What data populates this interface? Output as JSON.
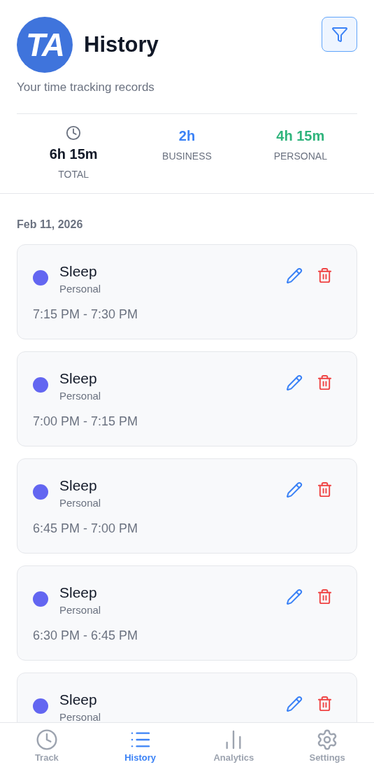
{
  "header": {
    "logo": "TA",
    "title": "History",
    "subtitle": "Your time tracking records"
  },
  "stats": [
    {
      "kind": "total",
      "value": "6h 15m",
      "label": "TOTAL"
    },
    {
      "kind": "business",
      "value": "2h",
      "label": "BUSINESS"
    },
    {
      "kind": "personal",
      "value": "4h 15m",
      "label": "PERSONAL"
    }
  ],
  "date": "Feb 11, 2026",
  "entries": [
    {
      "title": "Sleep",
      "category": "Personal",
      "color": "#6366f1",
      "time": "7:15 PM - 7:30 PM"
    },
    {
      "title": "Sleep",
      "category": "Personal",
      "color": "#6366f1",
      "time": "7:00 PM - 7:15 PM"
    },
    {
      "title": "Sleep",
      "category": "Personal",
      "color": "#6366f1",
      "time": "6:45 PM - 7:00 PM"
    },
    {
      "title": "Sleep",
      "category": "Personal",
      "color": "#6366f1",
      "time": "6:30 PM - 6:45 PM"
    },
    {
      "title": "Sleep",
      "category": "Personal",
      "color": "#6366f1"
    }
  ],
  "nav": [
    {
      "kind": "clock",
      "label": "Track",
      "selected": false
    },
    {
      "kind": "list",
      "label": "History",
      "selected": true
    },
    {
      "kind": "chart",
      "label": "Analytics",
      "selected": false
    },
    {
      "kind": "gear",
      "label": "Settings",
      "selected": false
    }
  ]
}
